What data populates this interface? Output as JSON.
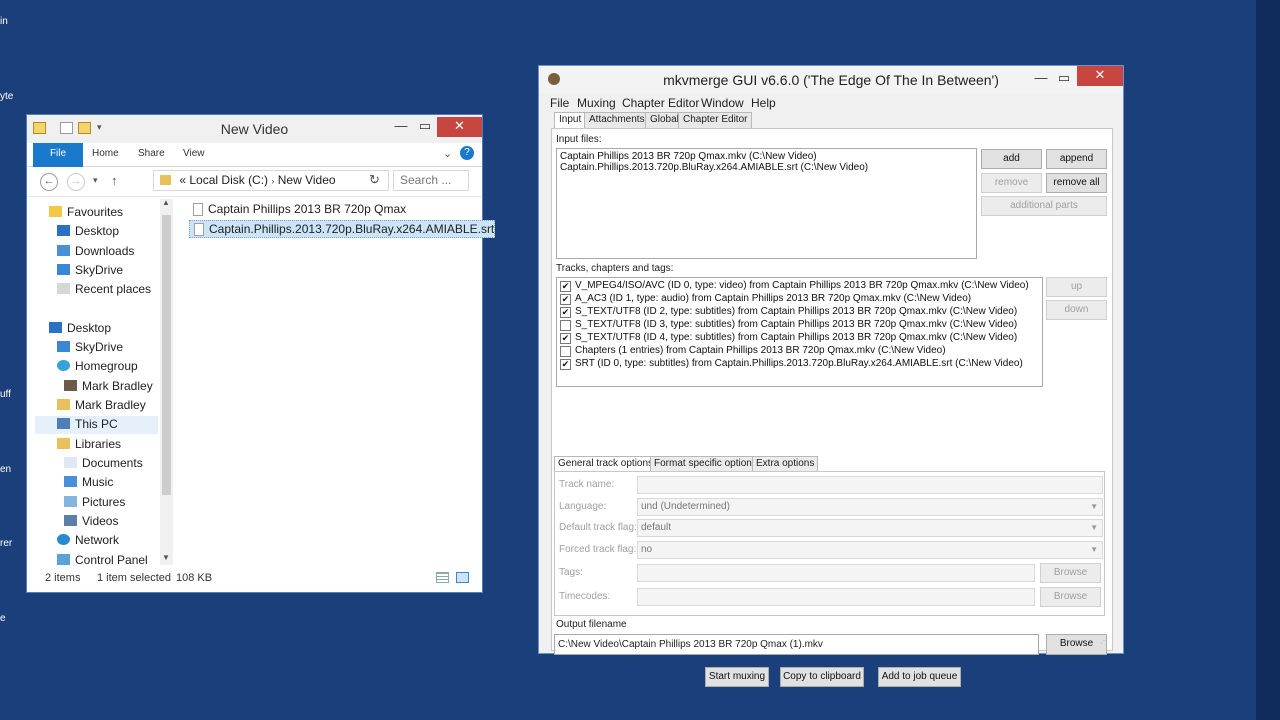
{
  "desktop": {
    "edge_labels": [
      "in",
      "yte",
      "uff",
      "en",
      "rer",
      "e"
    ]
  },
  "explorer": {
    "title": "New Video",
    "ribbon_tabs": [
      "File",
      "Home",
      "Share",
      "View"
    ],
    "address": {
      "root": "Local Disk (C:)",
      "folder": "New Video",
      "prefix": "«"
    },
    "search_placeholder": "Search ...",
    "nav": {
      "favourites": "Favourites",
      "desktop_fav": "Desktop",
      "downloads": "Downloads",
      "skydrive_fav": "SkyDrive",
      "recent": "Recent places",
      "desktop": "Desktop",
      "skydrive": "SkyDrive",
      "homegroup": "Homegroup",
      "user1": "Mark Bradley",
      "user2": "Mark Bradley",
      "thispc": "This PC",
      "libraries": "Libraries",
      "documents": "Documents",
      "music": "Music",
      "pictures": "Pictures",
      "videos": "Videos",
      "network": "Network",
      "controlpanel": "Control Panel"
    },
    "files": [
      "Captain Phillips 2013 BR 720p Qmax",
      "Captain.Phillips.2013.720p.BluRay.x264.AMIABLE.srt"
    ],
    "status": {
      "items": "2 items",
      "selected": "1 item selected",
      "size": "108 KB"
    }
  },
  "mkv": {
    "title": "mkvmerge GUI v6.6.0 ('The Edge Of The In Between')",
    "menu": [
      "File",
      "Muxing",
      "Chapter Editor",
      "Window",
      "Help"
    ],
    "tabs": [
      "Input",
      "Attachments",
      "Global",
      "Chapter Editor"
    ],
    "input_files_label": "Input files:",
    "input_files": [
      "Captain Phillips 2013 BR 720p Qmax.mkv (C:\\New Video)",
      "Captain.Phillips.2013.720p.BluRay.x264.AMIABLE.srt (C:\\New Video)"
    ],
    "buttons": {
      "add": "add",
      "append": "append",
      "remove": "remove",
      "remove_all": "remove all",
      "additional_parts": "additional parts",
      "up": "up",
      "down": "down",
      "browse_tags": "Browse",
      "browse_timecodes": "Browse",
      "browse_output": "Browse",
      "start_muxing": "Start muxing",
      "copy_clipboard": "Copy to clipboard",
      "add_job_queue": "Add to job queue"
    },
    "tracks_label": "Tracks, chapters and tags:",
    "tracks": [
      {
        "checked": true,
        "text": "V_MPEG4/ISO/AVC (ID 0, type: video) from Captain Phillips 2013 BR 720p Qmax.mkv (C:\\New Video)"
      },
      {
        "checked": true,
        "text": "A_AC3 (ID 1, type: audio) from Captain Phillips 2013 BR 720p Qmax.mkv (C:\\New Video)"
      },
      {
        "checked": true,
        "text": "S_TEXT/UTF8 (ID 2, type: subtitles) from Captain Phillips 2013 BR 720p Qmax.mkv (C:\\New Video)"
      },
      {
        "checked": false,
        "text": "S_TEXT/UTF8 (ID 3, type: subtitles) from Captain Phillips 2013 BR 720p Qmax.mkv (C:\\New Video)"
      },
      {
        "checked": true,
        "text": "S_TEXT/UTF8 (ID 4, type: subtitles) from Captain Phillips 2013 BR 720p Qmax.mkv (C:\\New Video)"
      },
      {
        "checked": false,
        "text": "Chapters (1 entries) from Captain Phillips 2013 BR 720p Qmax.mkv (C:\\New Video)"
      },
      {
        "checked": true,
        "text": "SRT (ID 0, type: subtitles) from Captain.Phillips.2013.720p.BluRay.x264.AMIABLE.srt (C:\\New Video)"
      }
    ],
    "subtabs": [
      "General track options",
      "Format specific options",
      "Extra options"
    ],
    "options": {
      "track_name_label": "Track name:",
      "language_label": "Language:",
      "language_value": "und (Undetermined)",
      "default_flag_label": "Default track flag:",
      "default_flag_value": "default",
      "forced_flag_label": "Forced track flag:",
      "forced_flag_value": "no",
      "tags_label": "Tags:",
      "timecodes_label": "Timecodes:"
    },
    "output_label": "Output filename",
    "output_value": "C:\\New Video\\Captain Phillips 2013 BR 720p Qmax (1).mkv"
  }
}
